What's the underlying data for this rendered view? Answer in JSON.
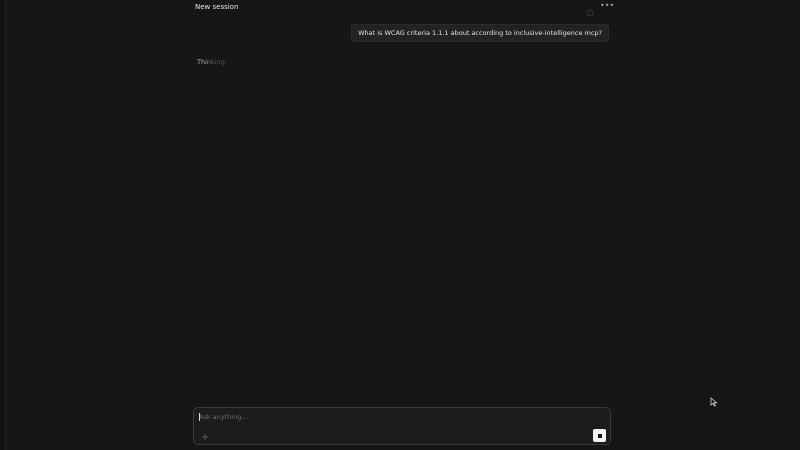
{
  "session": {
    "title": "New session"
  },
  "header": {
    "status_icon": "circle-outline-icon",
    "more_icon": "more-horizontal-icon",
    "more_glyph": "•••"
  },
  "messages": [
    {
      "role": "user",
      "text": "What is WCAG criteria 1.1.1 about according to inclusive-intelligence mcp?"
    }
  ],
  "assistant": {
    "status_text": "Thinking"
  },
  "composer": {
    "placeholder": "Ask anything...",
    "value": "",
    "add_icon": "plus-icon",
    "stop_icon": "stop-icon"
  },
  "colors": {
    "background": "#161616",
    "bubble": "#232323",
    "composer_border": "#3a3a3a",
    "stop_button": "#f2f2f2"
  }
}
